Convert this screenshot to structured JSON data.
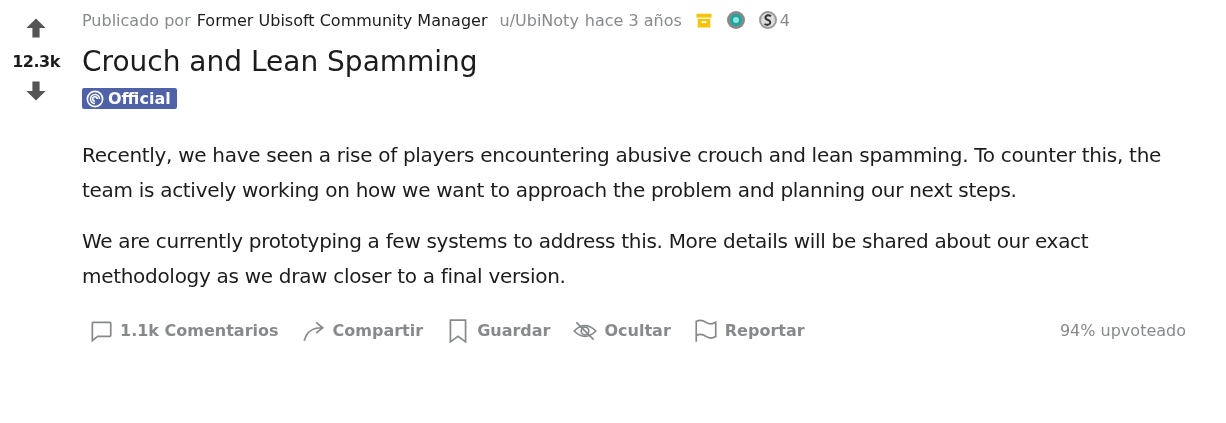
{
  "vote": {
    "score": "12.3k"
  },
  "meta": {
    "prefix": "Publicado por",
    "author": "Former Ubisoft Community Manager",
    "user": "u/UbiNoty",
    "time": "hace 3 años",
    "award_count": "4"
  },
  "title": "Crouch and Lean Spamming",
  "flair": {
    "label": "Official"
  },
  "body": [
    "Recently, we have seen a rise of players encountering abusive crouch and lean spamming. To counter this, the team is actively working on how we want to approach the problem and planning our next steps.",
    "We are currently prototyping a few systems to address this. More details will be shared about our exact methodology as we draw closer to a final version."
  ],
  "actions": [
    {
      "kind": "comment",
      "label": "1.1k Comentarios"
    },
    {
      "kind": "share",
      "label": "Compartir"
    },
    {
      "kind": "save",
      "label": "Guardar"
    },
    {
      "kind": "hide",
      "label": "Ocultar"
    },
    {
      "kind": "report",
      "label": "Reportar"
    }
  ],
  "upvote_ratio": "94% upvoteado"
}
